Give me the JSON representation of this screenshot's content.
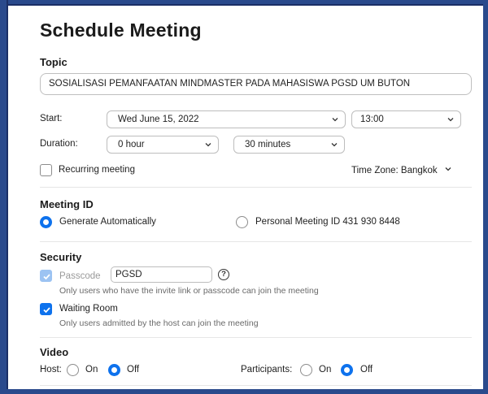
{
  "dialog": {
    "title": "Schedule Meeting"
  },
  "topic": {
    "heading": "Topic",
    "value": "SOSIALISASI PEMANFAATAN MINDMASTER PADA MAHASISWA PGSD UM BUTON"
  },
  "start": {
    "label": "Start:",
    "date": "Wed  June  15,  2022",
    "time": "13:00"
  },
  "duration": {
    "label": "Duration:",
    "hours": "0 hour",
    "minutes": "30 minutes"
  },
  "recurring": {
    "label": "Recurring meeting",
    "checked": false
  },
  "timezone": {
    "label": "Time Zone: Bangkok"
  },
  "meeting_id": {
    "heading": "Meeting ID",
    "generate_label": "Generate Automatically",
    "personal_label": "Personal Meeting ID 431 930 8448",
    "selected": "generate"
  },
  "security": {
    "heading": "Security",
    "passcode_label": "Passcode",
    "passcode_value": "PGSD",
    "help_glyph": "?",
    "passcode_hint": "Only users who have the invite link or passcode can join the meeting",
    "waiting_room_label": "Waiting Room",
    "waiting_room_hint": "Only users admitted by the host can join the meeting",
    "passcode_checked": true,
    "waiting_room_checked": true
  },
  "video": {
    "heading": "Video",
    "host_label": "Host:",
    "participants_label": "Participants:",
    "on_label": "On",
    "off_label": "Off",
    "host_selected": "off",
    "participants_selected": "off"
  },
  "colors": {
    "accent": "#0e72ed",
    "frame": "#2a4a8c"
  }
}
